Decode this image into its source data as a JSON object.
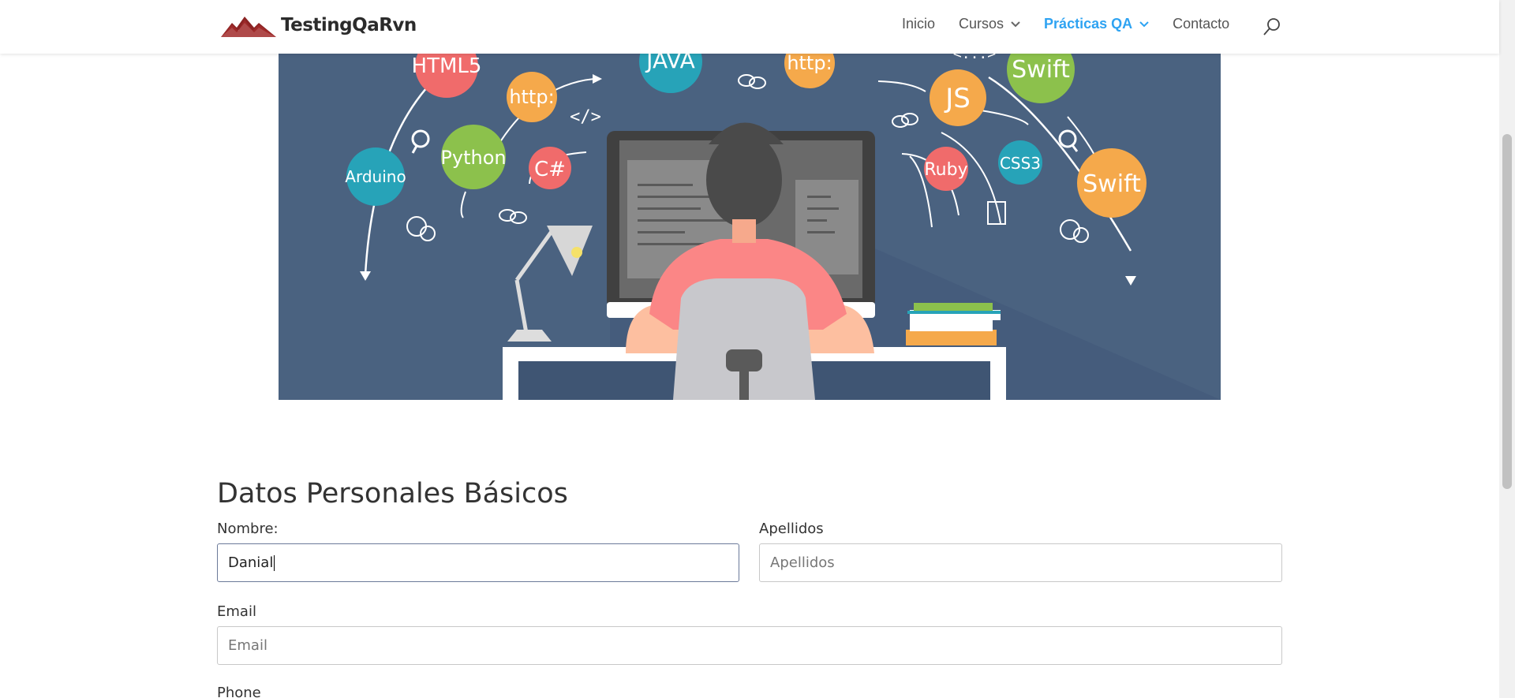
{
  "header": {
    "logo_text": "TestingQaRvn",
    "nav": [
      {
        "label": "Inicio"
      },
      {
        "label": "Cursos"
      },
      {
        "label": "Prácticas QA"
      },
      {
        "label": "Contacto"
      }
    ]
  },
  "hero": {
    "tags": [
      "HTML5",
      "JAVA",
      "http:",
      "http:",
      "Swift",
      "JS",
      "Python",
      "C#",
      "Arduino",
      "Ruby",
      "CSS3",
      "Swift",
      "</>",
      "<...>"
    ]
  },
  "form": {
    "title": "Datos Personales Básicos",
    "nombre": {
      "label": "Nombre:",
      "value": "Danial"
    },
    "apellidos": {
      "label": "Apellidos",
      "placeholder": "Apellidos"
    },
    "email": {
      "label": "Email",
      "placeholder": "Email"
    },
    "phone": {
      "label": "Phone"
    }
  },
  "colors": {
    "accent": "#2ea3f2",
    "hero_bg": "#4a6280",
    "logo_mountain": "#8b2323"
  }
}
